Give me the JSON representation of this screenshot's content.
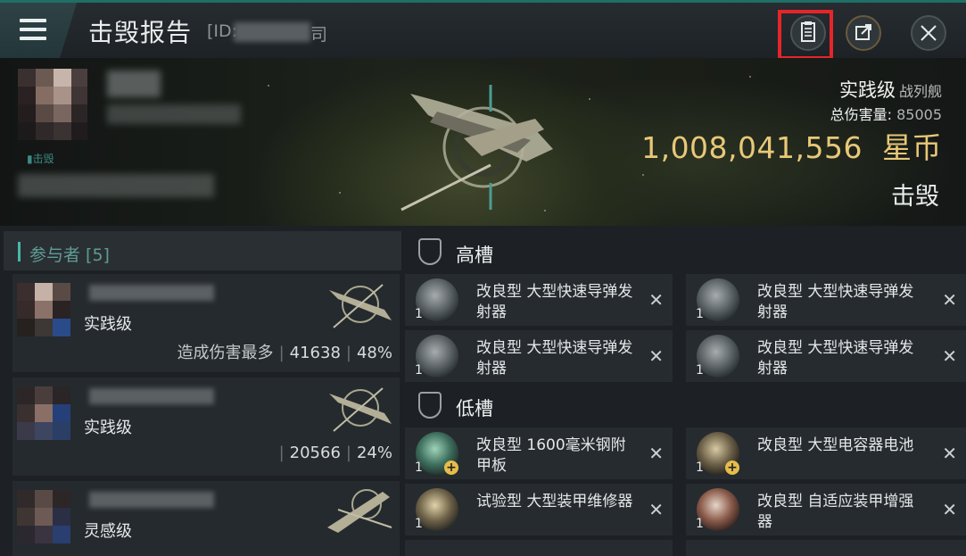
{
  "header": {
    "title": "击毁报告",
    "id_prefix": "[ID:",
    "id_suffix": "司"
  },
  "victim": {
    "small_tag": "▮击毁",
    "ship_class": "实践级",
    "ship_type": "战列舰",
    "damage_label": "总伤害量:",
    "damage_value": "85005",
    "isk_value": "1,008,041,556",
    "isk_unit": "星币",
    "status": "击毁"
  },
  "participants": {
    "header": "参与者 [5]",
    "rows": [
      {
        "ship": "实践级",
        "stat_label": "造成伤害最多",
        "damage": "41638",
        "percent": "48%"
      },
      {
        "ship": "实践级",
        "stat_label": "",
        "damage": "20566",
        "percent": "24%"
      },
      {
        "ship": "灵感级",
        "stat_label": "",
        "damage": "",
        "percent": ""
      }
    ]
  },
  "slots": {
    "high_label": "高槽",
    "low_label": "低槽",
    "high": [
      {
        "qty": "1",
        "name": "改良型 大型快速导弹发射器"
      },
      {
        "qty": "1",
        "name": "改良型 大型快速导弹发射器"
      },
      {
        "qty": "1",
        "name": "改良型 大型快速导弹发射器"
      },
      {
        "qty": "1",
        "name": "改良型 大型快速导弹发射器"
      }
    ],
    "low": [
      {
        "qty": "1",
        "name": "改良型 1600毫米钢附甲板"
      },
      {
        "qty": "1",
        "name": "改良型 大型电容器电池"
      },
      {
        "qty": "1",
        "name": "试验型 大型装甲维修器"
      },
      {
        "qty": "1",
        "name": "改良型 自适应装甲增强器"
      }
    ],
    "remove_symbol": "✕"
  },
  "colors": {
    "accent": "#49b7a7",
    "isk": "#e8c878",
    "highlight": "#e5252a"
  }
}
